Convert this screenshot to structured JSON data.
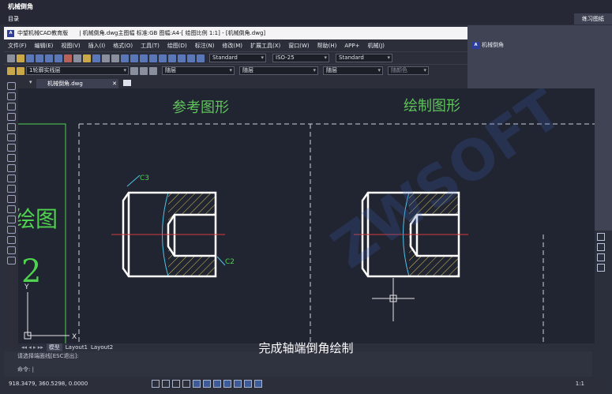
{
  "outer": {
    "title": "机械倒角",
    "menu": "目录",
    "practice_tab": "练习图纸"
  },
  "right_panel": {
    "item": "机械倒角",
    "logo": "A"
  },
  "cad": {
    "app_name": "中望机械CAD教育版",
    "file_title": "| 机械倒角.dwg主图幅  标准:GB 图幅:A4-[ 绘图比例 1:1] - [机械倒角.dwg]",
    "menu": [
      "文件(F)",
      "编辑(E)",
      "视图(V)",
      "插入(I)",
      "格式(O)",
      "工具(T)",
      "绘图(D)",
      "标注(N)",
      "修改(M)",
      "扩展工具(X)",
      "窗口(W)",
      "帮助(H)",
      "APP+",
      "机械(J)"
    ],
    "text_style": "Standard",
    "dim_style": "ISO-25",
    "table_style": "Standard",
    "layer": "1轮廓实线层",
    "color": "随层",
    "linetype": "随层",
    "lineweight": "随层",
    "plot_color": "随颜色"
  },
  "doc_tab": {
    "name": "机械倒角.dwg"
  },
  "drawing": {
    "label_reference": "参考图形",
    "label_draw": "绘制图形",
    "callout_c3": "C3",
    "callout_c2": "C2",
    "left_text": "绘图",
    "left_digit": "2",
    "axis_y": "Y",
    "axis_x": "X"
  },
  "layout_tabs": [
    "模型",
    "Layout1",
    "Layout2"
  ],
  "command": {
    "history": "请选择端面线[ESC退出]:",
    "prompt": "命令:"
  },
  "caption": "完成轴端倒角绘制",
  "status": {
    "coords": "918.3479, 360.5298, 0.0000",
    "scale": "1:1"
  }
}
